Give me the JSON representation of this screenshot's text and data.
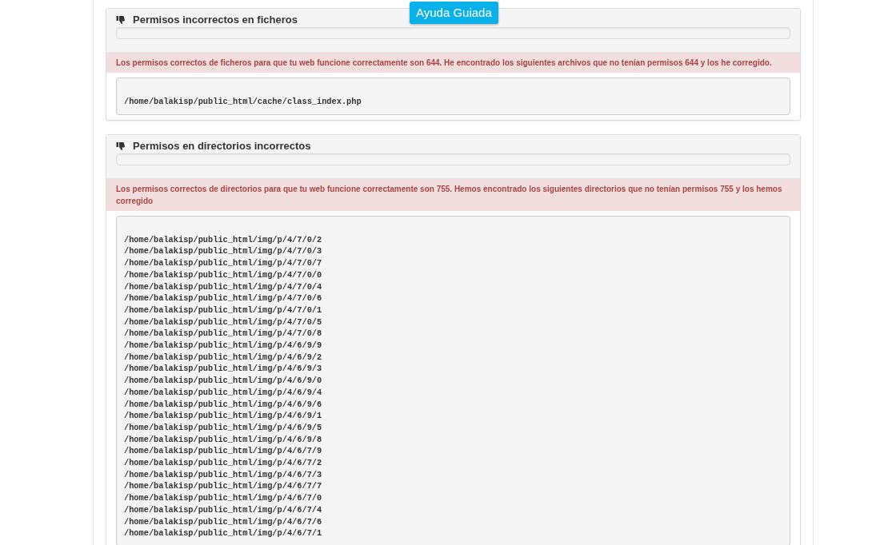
{
  "guided_help_button": "Ayuda Guiada",
  "panels": [
    {
      "title": "Permisos incorrectos en ficheros",
      "progress": {
        "level": 0
      },
      "alert": "Los permisos correctos de ficheros para que tu web funcione correctamente son 644. He encontrado los siguientes archivos que no tenían permisos 644 y los he corregido.",
      "paths": [
        "/home/balakisp/public_html/cache/class_index.php"
      ]
    },
    {
      "title": "Permisos en directorios incorrectos",
      "progress": {
        "level": 0
      },
      "alert": "Los permisos correctos de directorios para que tu web funcione correctamente son 755. Hemos encontrado los siguientes directorios que no tenían permisos 755 y los hemos corregido",
      "paths": [
        "/home/balakisp/public_html/img/p/4/7/0/2",
        "/home/balakisp/public_html/img/p/4/7/0/3",
        "/home/balakisp/public_html/img/p/4/7/0/7",
        "/home/balakisp/public_html/img/p/4/7/0/0",
        "/home/balakisp/public_html/img/p/4/7/0/4",
        "/home/balakisp/public_html/img/p/4/7/0/6",
        "/home/balakisp/public_html/img/p/4/7/0/1",
        "/home/balakisp/public_html/img/p/4/7/0/5",
        "/home/balakisp/public_html/img/p/4/7/0/8",
        "/home/balakisp/public_html/img/p/4/6/9/9",
        "/home/balakisp/public_html/img/p/4/6/9/2",
        "/home/balakisp/public_html/img/p/4/6/9/3",
        "/home/balakisp/public_html/img/p/4/6/9/0",
        "/home/balakisp/public_html/img/p/4/6/9/4",
        "/home/balakisp/public_html/img/p/4/6/9/6",
        "/home/balakisp/public_html/img/p/4/6/9/1",
        "/home/balakisp/public_html/img/p/4/6/9/5",
        "/home/balakisp/public_html/img/p/4/6/9/8",
        "/home/balakisp/public_html/img/p/4/6/7/9",
        "/home/balakisp/public_html/img/p/4/6/7/2",
        "/home/balakisp/public_html/img/p/4/6/7/3",
        "/home/balakisp/public_html/img/p/4/6/7/7",
        "/home/balakisp/public_html/img/p/4/6/7/0",
        "/home/balakisp/public_html/img/p/4/6/7/4",
        "/home/balakisp/public_html/img/p/4/6/7/6",
        "/home/balakisp/public_html/img/p/4/6/7/1"
      ]
    }
  ]
}
